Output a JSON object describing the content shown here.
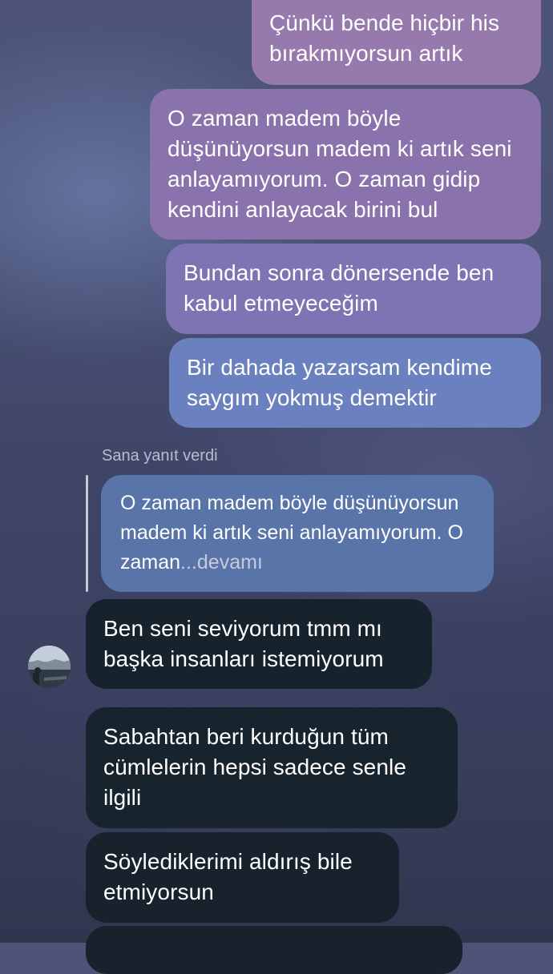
{
  "messages_sent": [
    "Çünkü bende hiçbir his bırakmıyorsun artık",
    "O zaman madem böyle düşünüyorsun madem ki artık seni anlayamıyorum. O zaman gidip kendini anlayacak birini bul",
    "Bundan sonra dönersende ben kabul etmeyeceğim",
    "Bir dahada yazarsam kendime saygım yokmuş demektir"
  ],
  "reply": {
    "label": "Sana yanıt verdi",
    "quoted_text": "O zaman madem böyle düşünüyorsun madem ki artık seni anlayamıyorum. O zaman",
    "more_label": "...devamı"
  },
  "messages_received": [
    "Ben seni seviyorum tmm mı başka insanları istemiyorum",
    "Sabahtan beri kurduğun tüm cümlelerin hepsi sadece senle ilgili",
    "Söylediklerimi aldırış bile etmiyorsun",
    ""
  ],
  "colors": {
    "sent_top": "#9679ad",
    "sent_bottom": "#6b80be",
    "received": "#17222c",
    "quote": "#5874a8"
  }
}
